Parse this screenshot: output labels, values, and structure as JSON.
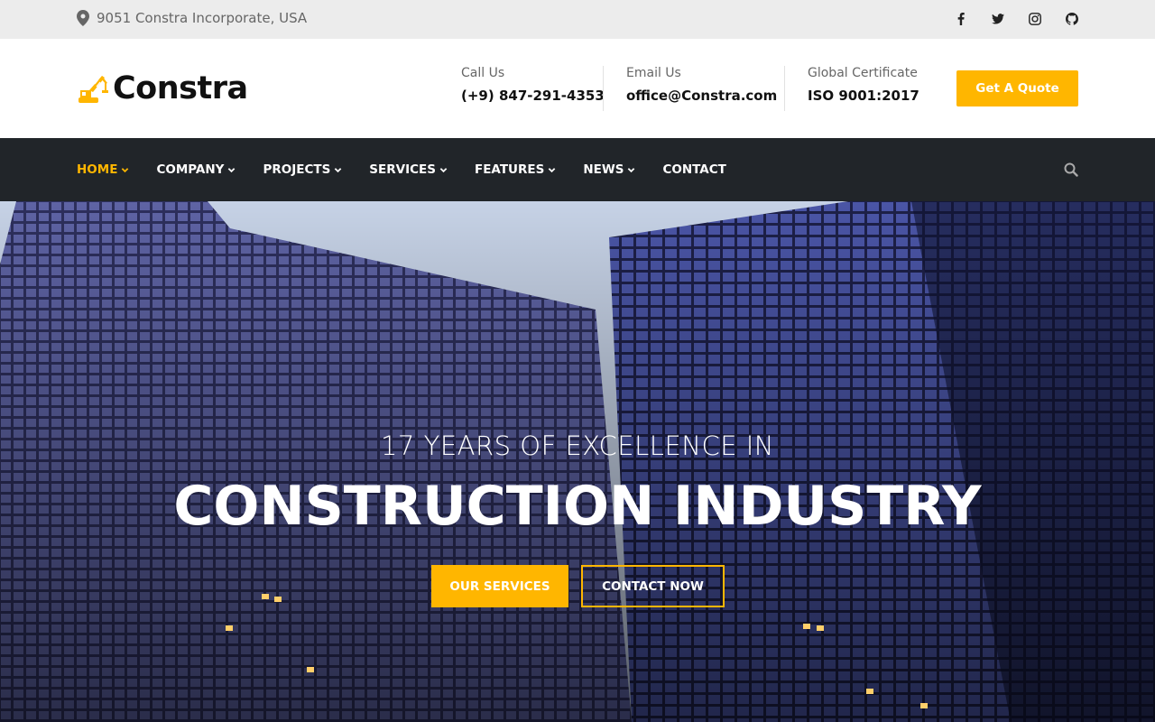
{
  "topbar": {
    "address": "9051 Constra Incorporate, USA",
    "address_icon": "map-marker-icon",
    "social": [
      "facebook-icon",
      "twitter-icon",
      "instagram-icon",
      "github-icon"
    ]
  },
  "header": {
    "logo_text": "Constra",
    "call": {
      "label": "Call Us",
      "value": "(+9) 847-291-4353"
    },
    "email": {
      "label": "Email Us",
      "value": "office@Constra.com"
    },
    "cert": {
      "label": "Global Certificate",
      "value": "ISO 9001:2017"
    },
    "quote_label": "Get A Quote"
  },
  "nav": {
    "items": [
      {
        "label": "HOME",
        "dropdown": true,
        "active": true
      },
      {
        "label": "COMPANY",
        "dropdown": true
      },
      {
        "label": "PROJECTS",
        "dropdown": true
      },
      {
        "label": "SERVICES",
        "dropdown": true
      },
      {
        "label": "FEATURES",
        "dropdown": true
      },
      {
        "label": "NEWS",
        "dropdown": true
      },
      {
        "label": "CONTACT",
        "dropdown": false
      }
    ],
    "search_icon": "search-icon"
  },
  "hero": {
    "subtitle": "17 YEARS OF EXCELLENCE IN",
    "title": "CONSTRUCTION INDUSTRY",
    "primary_button": "OUR SERVICES",
    "secondary_button": "CONTACT NOW"
  },
  "colors": {
    "accent": "#ffb600",
    "nav_bg": "#212529",
    "topbar_bg": "#ececec"
  }
}
